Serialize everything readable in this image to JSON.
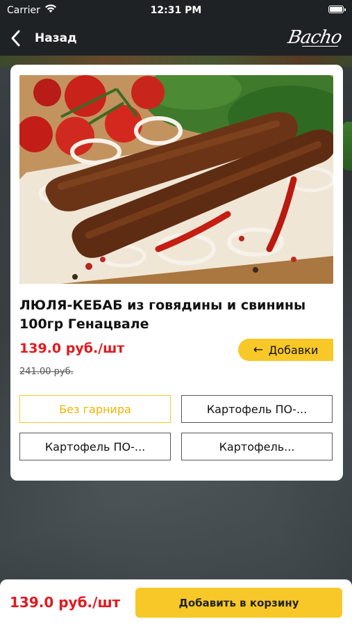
{
  "status_bar": {
    "carrier": "Carrier",
    "time": "12:31 PM"
  },
  "nav": {
    "back_label": "Назад",
    "logo_text": "Bacho"
  },
  "product": {
    "image_icon": "kebab-photo",
    "title": "ЛЮЛЯ-КЕБАБ из говядины и свинины 100гр Генацвале",
    "price": "139.0 руб./шт",
    "old_price": "241.00 руб.",
    "addons_label": "Добавки",
    "addons_arrow": "←",
    "options": [
      {
        "label": "Без гарнира",
        "selected": true
      },
      {
        "label": "Картофель ПО-...",
        "selected": false
      },
      {
        "label": "Картофель ПО-...",
        "selected": false
      },
      {
        "label": "Картофель...",
        "selected": false
      }
    ]
  },
  "footer": {
    "price": "139.0 руб./шт",
    "add_to_cart_label": "Добавить в корзину"
  },
  "colors": {
    "accent": "#f7c827",
    "price_red": "#e2191d",
    "header_bg": "#1f2224"
  }
}
